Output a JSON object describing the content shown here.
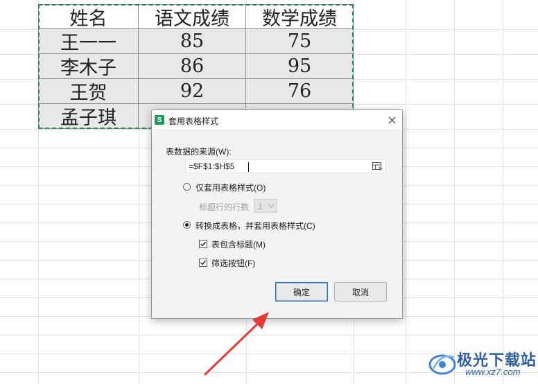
{
  "sheet": {
    "table": {
      "headers": [
        "姓名",
        "语文成绩",
        "数学成绩"
      ],
      "rows": [
        [
          "王一一",
          "85",
          "75"
        ],
        [
          "李木子",
          "86",
          "95"
        ],
        [
          "王贺",
          "92",
          "76"
        ],
        [
          "孟子琪",
          "",
          ""
        ]
      ]
    }
  },
  "dialog": {
    "app_icon": "S",
    "title": "套用表格样式",
    "source_label": "表数据的来源(W):",
    "source_value": "=$F$1:$H$5",
    "option_style_only": "仅套用表格样式(O)",
    "header_rows_label": "标题行的行数",
    "header_rows_value": "1",
    "option_convert": "转换成表格，并套用表格样式(C)",
    "check_include_header": "表包含标题(M)",
    "check_filter_buttons": "筛选按钮(F)",
    "ok_label": "确定",
    "cancel_label": "取消",
    "selected_option": "convert",
    "include_header_checked": true,
    "filter_buttons_checked": true
  },
  "watermark": {
    "name": "极光下载站",
    "url": "www.xz7.com"
  },
  "colors": {
    "selection_border": "#2b8a4b",
    "annotation_arrow": "#e53935",
    "ok_button_border": "#2a6fb8",
    "watermark": "#2a5fa8"
  }
}
